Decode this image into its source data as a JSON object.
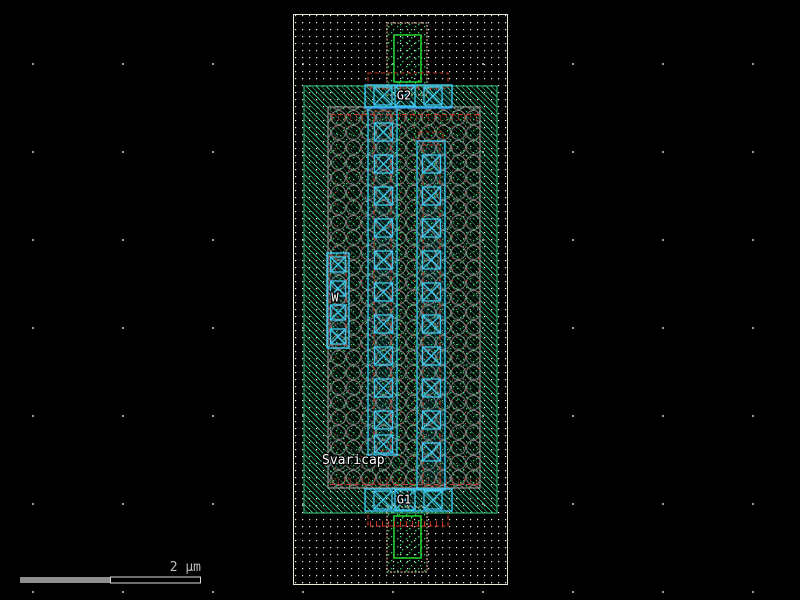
{
  "app": {
    "description": "IC layout editor canvas view"
  },
  "cell": {
    "name_label": "Svaricap",
    "pin_labels": {
      "top_gate": "G2",
      "bottom_gate": "G1",
      "well": "W"
    }
  },
  "scale_bar": {
    "label": "2 µm"
  },
  "grid": {
    "minor_dot_spacing_px": 7,
    "major_dot_spacing_px": 90
  },
  "layers": [
    "boundary",
    "nwell-hatch",
    "metal-fill-circles",
    "metal1-cyan",
    "via-contacts",
    "implant-red-dashed",
    "poly-green",
    "marker-tan"
  ],
  "colors": {
    "background": "#000000",
    "boundary": "#ece6d2",
    "well_hatch_light": "#3fbf7f",
    "well_hatch_dark": "#1d7a4a",
    "well_border": "#2fae6e",
    "region_gray": "#939393",
    "fill_circle_gray": "#7e7e7e",
    "metal_cyan": "#3cc6f0",
    "metal_blue": "#2f7fd9",
    "implant_red": "#c23a27",
    "poly_green": "#22cc33",
    "marker_tan": "#c6b091",
    "speckle_green": "#35d465",
    "label_text": "#ffffff",
    "scalebar_fill": "#8f8f8f",
    "dot_minor": "#f2f2f2",
    "dot_major": "#9b9b9b"
  }
}
